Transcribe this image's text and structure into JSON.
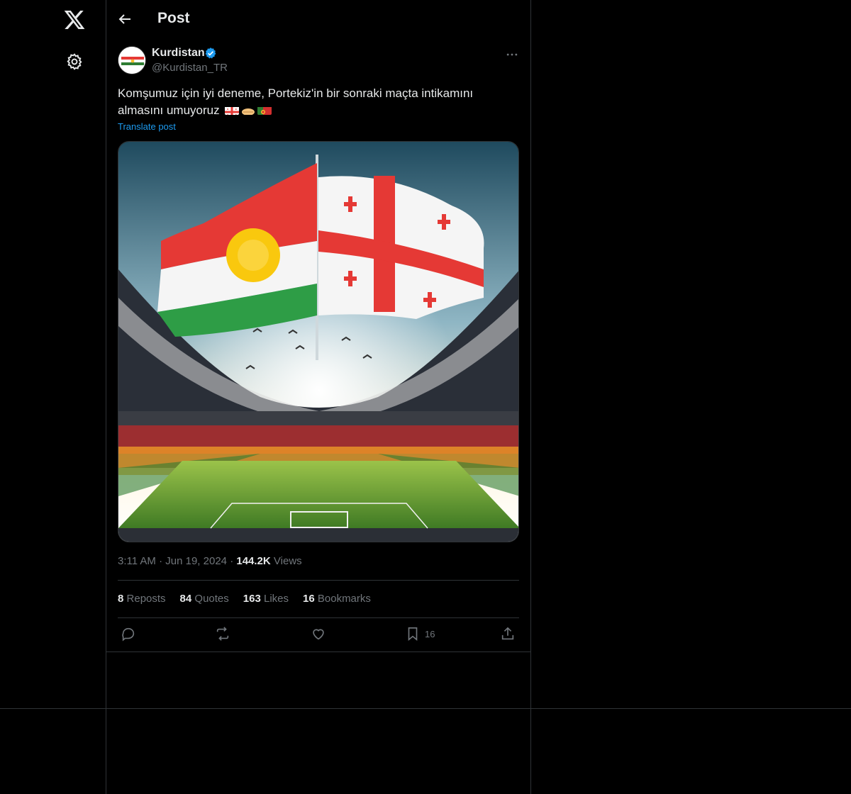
{
  "nav": {
    "logo_icon": "x-logo-icon",
    "settings_icon": "gear-icon"
  },
  "header": {
    "title": "Post",
    "back_icon": "arrow-left-icon"
  },
  "post": {
    "author": {
      "display_name": "Kurdistan",
      "handle": "@Kurdistan_TR",
      "verified": true,
      "verified_color": "#1d9bf0"
    },
    "text_line1": "Komşumuz için iyi deneme, Portekiz'in bir sonraki maçta intikamını",
    "text_line2": "almasını umuyoruz",
    "emojis": [
      "flag-georgia-icon",
      "handshake-icon",
      "flag-portugal-icon"
    ],
    "translate_label": "Translate post",
    "media_alt": "Stadium image with Kurdistan and Georgia flags",
    "time": "3:11 AM",
    "date": "Jun 19, 2024",
    "views_count": "144.2K",
    "views_label": "Views",
    "stats": {
      "reposts_count": "8",
      "reposts_label": "Reposts",
      "quotes_count": "84",
      "quotes_label": "Quotes",
      "likes_count": "163",
      "likes_label": "Likes",
      "bookmarks_count": "16",
      "bookmarks_label": "Bookmarks"
    },
    "actions": {
      "reply_icon": "reply-icon",
      "repost_icon": "repost-icon",
      "like_icon": "heart-icon",
      "bookmark_icon": "bookmark-icon",
      "bookmark_count": "16",
      "share_icon": "share-icon"
    }
  },
  "colors": {
    "background": "#000000",
    "text": "#e7e9ea",
    "muted": "#71767b",
    "accent": "#1d9bf0",
    "border": "#2f3336"
  }
}
